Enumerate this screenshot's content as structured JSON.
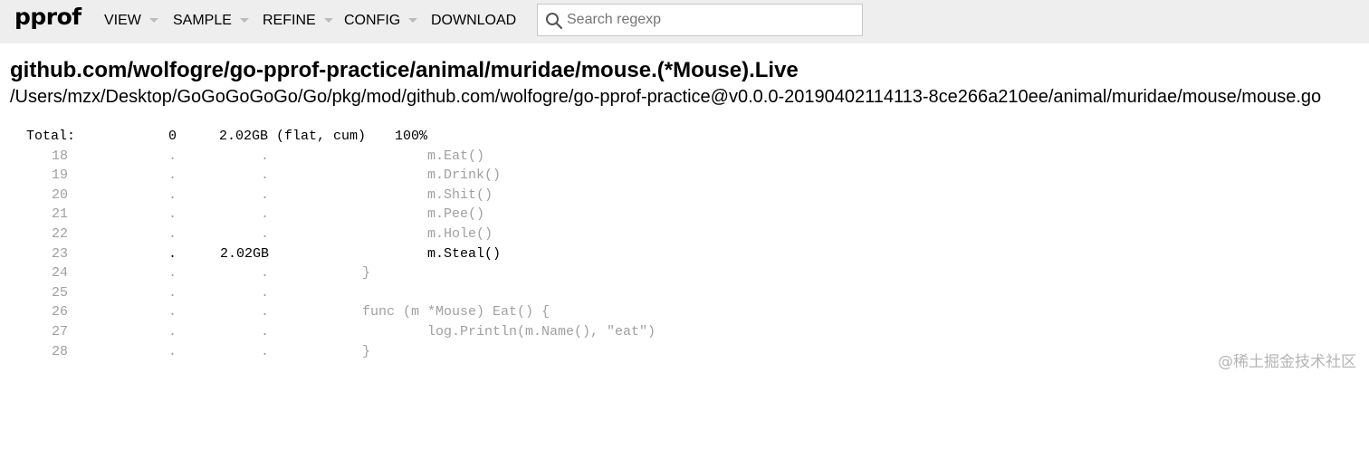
{
  "app": {
    "logo": "pprof"
  },
  "menu": [
    {
      "label": "VIEW",
      "has_dropdown": true
    },
    {
      "label": "SAMPLE",
      "has_dropdown": true
    },
    {
      "label": "REFINE",
      "has_dropdown": true
    },
    {
      "label": "CONFIG",
      "has_dropdown": true
    },
    {
      "label": "DOWNLOAD",
      "has_dropdown": false
    }
  ],
  "search": {
    "placeholder": "Search regexp",
    "value": "",
    "icon": "search-icon"
  },
  "function": {
    "name": "github.com/wolfogre/go-pprof-practice/animal/muridae/mouse.(*Mouse).Live",
    "file": "/Users/mzx/Desktop/GoGoGoGoGo/Go/pkg/mod/github.com/wolfogre/go-pprof-practice@v0.0.0-20190402114113-8ce266a210ee/animal/muridae/mouse/mouse.go"
  },
  "total": {
    "label": "Total:",
    "flat": "0",
    "cum": "2.02GB (flat, cum)",
    "percent": "100%"
  },
  "lines": [
    {
      "line": "18",
      "flat": ".",
      "cum": ".",
      "source": "        m.Eat()",
      "hot": false
    },
    {
      "line": "19",
      "flat": ".",
      "cum": ".",
      "source": "        m.Drink()",
      "hot": false
    },
    {
      "line": "20",
      "flat": ".",
      "cum": ".",
      "source": "        m.Shit()",
      "hot": false
    },
    {
      "line": "21",
      "flat": ".",
      "cum": ".",
      "source": "        m.Pee()",
      "hot": false
    },
    {
      "line": "22",
      "flat": ".",
      "cum": ".",
      "source": "        m.Hole()",
      "hot": false
    },
    {
      "line": "23",
      "flat": ".",
      "cum": "2.02GB",
      "source": "        m.Steal()",
      "hot": true
    },
    {
      "line": "24",
      "flat": ".",
      "cum": ".",
      "source": "}",
      "hot": false
    },
    {
      "line": "25",
      "flat": ".",
      "cum": ".",
      "source": "",
      "hot": false
    },
    {
      "line": "26",
      "flat": ".",
      "cum": ".",
      "source": "func (m *Mouse) Eat() {",
      "hot": false
    },
    {
      "line": "27",
      "flat": ".",
      "cum": ".",
      "source": "        log.Println(m.Name(), \"eat\")",
      "hot": false
    },
    {
      "line": "28",
      "flat": ".",
      "cum": ".",
      "source": "}",
      "hot": false
    }
  ],
  "watermark": "@稀土掘金技术社区"
}
